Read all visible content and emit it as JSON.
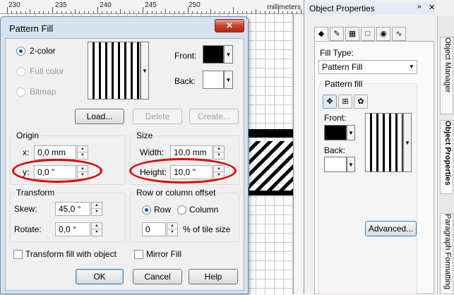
{
  "ruler": {
    "numbers": [
      "230",
      "235",
      "240",
      "245",
      "250"
    ],
    "unit": "millimeters"
  },
  "dialog": {
    "title": "Pattern Fill",
    "close_glyph": "✕",
    "fill_mode": {
      "options": [
        "2-color",
        "Full color",
        "Bitmap"
      ],
      "selected": "2-color"
    },
    "front_label": "Front:",
    "back_label": "Back:",
    "front_color": "#000000",
    "back_color": "#ffffff",
    "buttons": {
      "load": "Load...",
      "delete": "Delete",
      "create": "Create..."
    },
    "origin": {
      "title": "Origin",
      "x_label": "x:",
      "x_value": "0,0 mm",
      "y_label": "y:",
      "y_value": "0,0 \""
    },
    "size": {
      "title": "Size",
      "width_label": "Width:",
      "width_value": "10,0 mm",
      "height_label": "Height:",
      "height_value": "10,0 \""
    },
    "transform": {
      "title": "Transform",
      "skew_label": "Skew:",
      "skew_value": "45,0 °",
      "rotate_label": "Rotate:",
      "rotate_value": "0,0 °"
    },
    "offset": {
      "title": "Row or column offset",
      "row_label": "Row",
      "column_label": "Column",
      "selected": "Row",
      "value": "0",
      "suffix": "% of tile size"
    },
    "transform_fill_label": "Transform fill with object",
    "mirror_fill_label": "Mirror Fill",
    "ok_label": "OK",
    "cancel_label": "Cancel",
    "help_label": "Help"
  },
  "panel": {
    "title": "Object Properties",
    "fill_type_label": "Fill Type:",
    "fill_type_value": "Pattern Fill",
    "pattern_fill_label": "Pattern fill",
    "front_label": "Front:",
    "back_label": "Back:",
    "advanced_label": "Advanced...",
    "side_tabs": [
      "Object Manager",
      "Object Properties",
      "Paragraph Formatting"
    ],
    "front_color": "#000000",
    "back_color": "#ffffff",
    "highlight_color": "#e00000"
  }
}
